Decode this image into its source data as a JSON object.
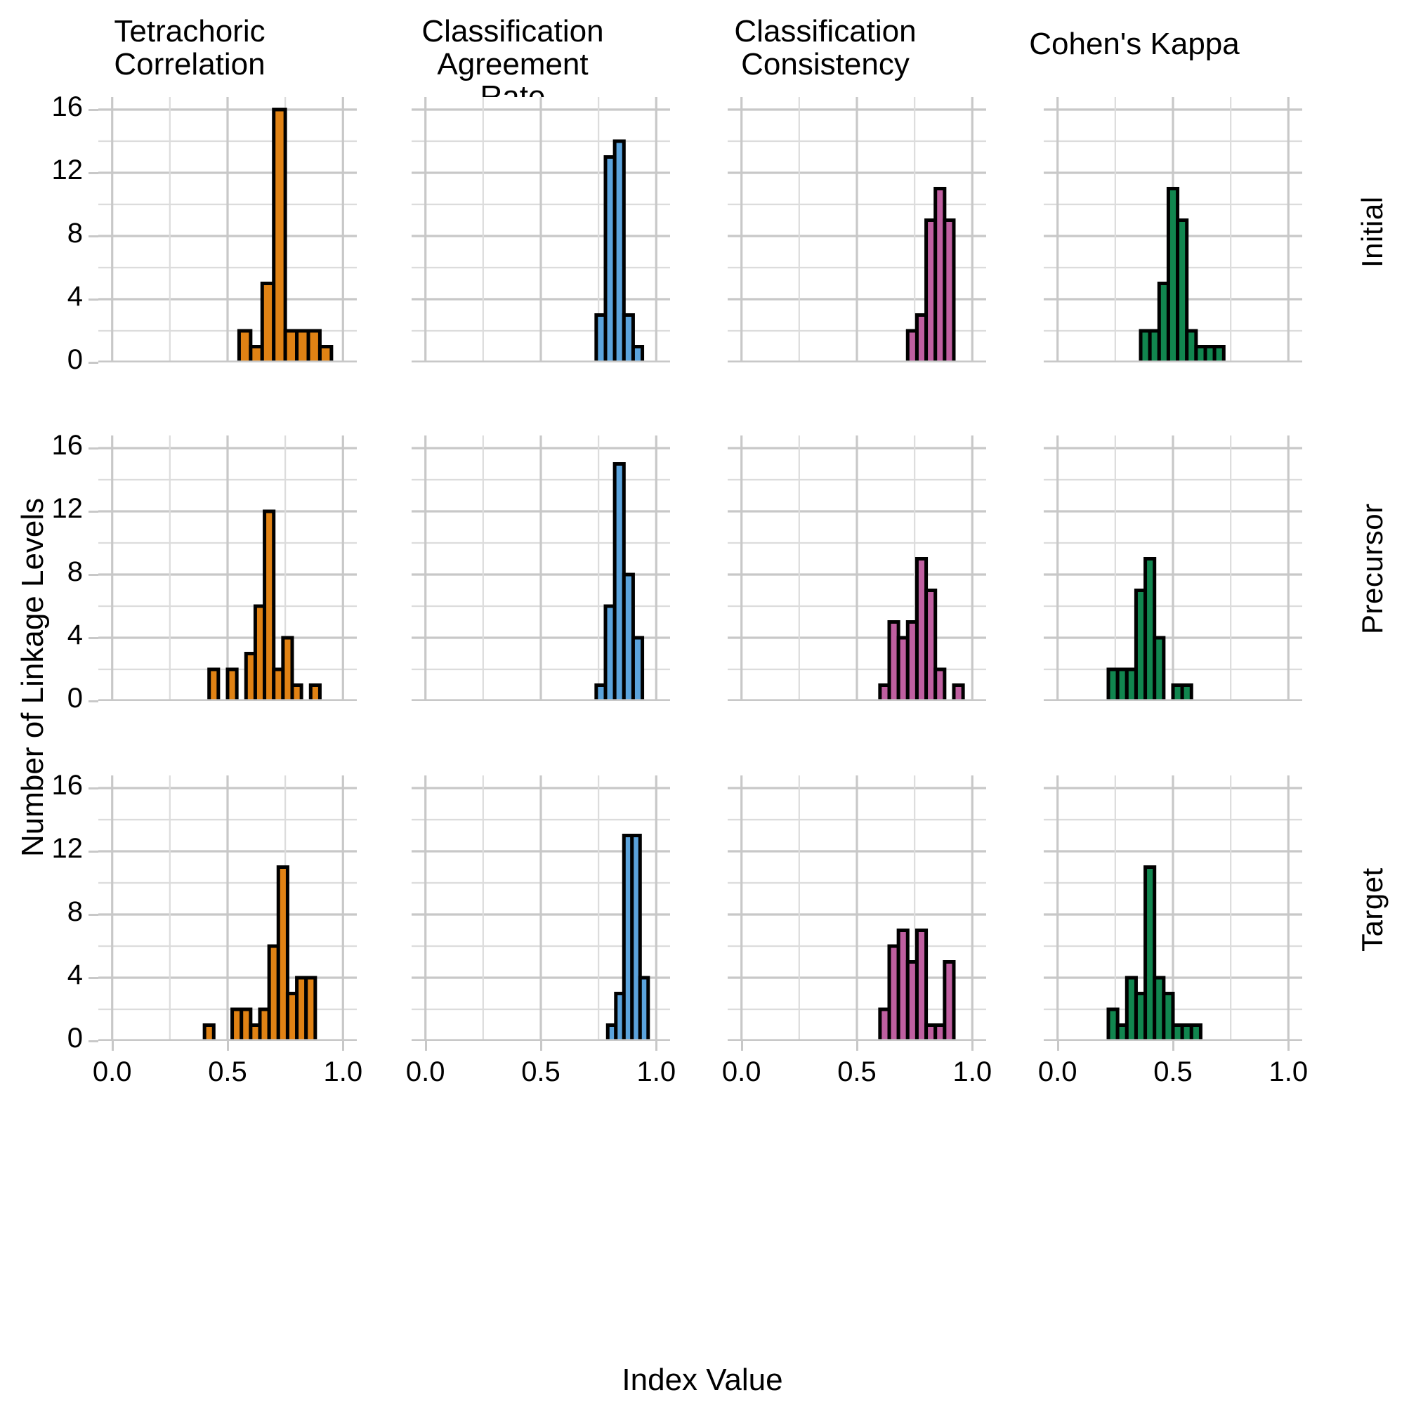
{
  "figure": {
    "xlabel": "Index Value",
    "ylabel": "Number of Linkage Levels",
    "column_titles": [
      "Tetrachoric\nCorrelation",
      "Classification\nAgreement Rate",
      "Classification\nConsistency",
      "Cohen's Kappa"
    ],
    "row_titles": [
      "Initial",
      "Precursor",
      "Target"
    ],
    "colors": {
      "tetrachoric": "#E08214",
      "agreement": "#5BA3DC",
      "consistency": "#BF5FA0",
      "kappa": "#11864F",
      "bar_outline": "#000000",
      "grid_major": "#C8C8C8",
      "grid_minor": "#DCDCDC",
      "background": "#FFFFFF"
    },
    "y_ticks": [
      "0",
      "4",
      "8",
      "12",
      "16"
    ],
    "y_tick_values": [
      0,
      4,
      8,
      12,
      16
    ],
    "y_minor_values": [
      2,
      6,
      10,
      14
    ],
    "x_ticks": [
      "0.0",
      "0.5",
      "1.0"
    ],
    "x_tick_values": [
      0.0,
      0.5,
      1.0
    ],
    "x_minor_values": [
      0.25,
      0.75
    ],
    "ylim": [
      0,
      16.8
    ],
    "xlim": [
      -0.06,
      1.06
    ]
  },
  "chart_data": [
    {
      "type": "bar",
      "panel": "Initial / Tetrachoric Correlation",
      "row": "Initial",
      "column": "Tetrachoric Correlation",
      "title": "Tetrachoric Correlation",
      "xlabel": "Index Value",
      "ylabel": "Number of Linkage Levels",
      "xlim": [
        0.0,
        1.0
      ],
      "ylim": [
        0,
        16
      ],
      "grid": true,
      "color": "#E08214",
      "bin_width": 0.05,
      "bin_starts": [
        0.55,
        0.6,
        0.65,
        0.7,
        0.75,
        0.8,
        0.85,
        0.9
      ],
      "values": [
        2,
        1,
        5,
        16,
        2,
        2,
        2,
        1
      ]
    },
    {
      "type": "bar",
      "panel": "Initial / Classification Agreement Rate",
      "row": "Initial",
      "column": "Classification Agreement Rate",
      "title": "Classification Agreement Rate",
      "xlabel": "Index Value",
      "ylabel": "Number of Linkage Levels",
      "xlim": [
        0.0,
        1.0
      ],
      "ylim": [
        0,
        16
      ],
      "grid": true,
      "color": "#5BA3DC",
      "bin_width": 0.04,
      "bin_starts": [
        0.74,
        0.78,
        0.82,
        0.86,
        0.9
      ],
      "values": [
        3,
        13,
        14,
        3,
        1
      ]
    },
    {
      "type": "bar",
      "panel": "Initial / Classification Consistency",
      "row": "Initial",
      "column": "Classification Consistency",
      "title": "Classification Consistency",
      "xlabel": "Index Value",
      "ylabel": "Number of Linkage Levels",
      "xlim": [
        0.0,
        1.0
      ],
      "ylim": [
        0,
        16
      ],
      "grid": true,
      "color": "#BF5FA0",
      "bin_width": 0.04,
      "bin_starts": [
        0.72,
        0.76,
        0.8,
        0.84,
        0.88
      ],
      "values": [
        2,
        3,
        9,
        11,
        9
      ]
    },
    {
      "type": "bar",
      "panel": "Initial / Cohen's Kappa",
      "row": "Initial",
      "column": "Cohen's Kappa",
      "title": "Cohen's Kappa",
      "xlabel": "Index Value",
      "ylabel": "Number of Linkage Levels",
      "xlim": [
        0.0,
        1.0
      ],
      "ylim": [
        0,
        16
      ],
      "grid": true,
      "color": "#11864F",
      "bin_width": 0.04,
      "bin_starts": [
        0.36,
        0.4,
        0.44,
        0.48,
        0.52,
        0.56,
        0.6,
        0.64,
        0.68
      ],
      "values": [
        2,
        2,
        5,
        11,
        9,
        2,
        1,
        1,
        1
      ]
    },
    {
      "type": "bar",
      "panel": "Precursor / Tetrachoric Correlation",
      "row": "Precursor",
      "column": "Tetrachoric Correlation",
      "title": "Tetrachoric Correlation",
      "xlabel": "Index Value",
      "ylabel": "Number of Linkage Levels",
      "xlim": [
        0.0,
        1.0
      ],
      "ylim": [
        0,
        16
      ],
      "grid": true,
      "color": "#E08214",
      "bin_width": 0.04,
      "bin_starts": [
        0.42,
        0.46,
        0.5,
        0.54,
        0.58,
        0.62,
        0.66,
        0.7,
        0.74,
        0.78,
        0.82,
        0.86
      ],
      "values": [
        2,
        0,
        2,
        0,
        3,
        6,
        12,
        2,
        4,
        1,
        0,
        1
      ]
    },
    {
      "type": "bar",
      "panel": "Precursor / Classification Agreement Rate",
      "row": "Precursor",
      "column": "Classification Agreement Rate",
      "title": "Classification Agreement Rate",
      "xlabel": "Index Value",
      "ylabel": "Number of Linkage Levels",
      "xlim": [
        0.0,
        1.0
      ],
      "ylim": [
        0,
        16
      ],
      "grid": true,
      "color": "#5BA3DC",
      "bin_width": 0.04,
      "bin_starts": [
        0.74,
        0.78,
        0.82,
        0.86,
        0.9
      ],
      "values": [
        1,
        6,
        15,
        8,
        4
      ]
    },
    {
      "type": "bar",
      "panel": "Precursor / Classification Consistency",
      "row": "Precursor",
      "column": "Classification Consistency",
      "title": "Classification Consistency",
      "xlabel": "Index Value",
      "ylabel": "Number of Linkage Levels",
      "xlim": [
        0.0,
        1.0
      ],
      "ylim": [
        0,
        16
      ],
      "grid": true,
      "color": "#BF5FA0",
      "bin_width": 0.04,
      "bin_starts": [
        0.6,
        0.64,
        0.68,
        0.72,
        0.76,
        0.8,
        0.84,
        0.88,
        0.92
      ],
      "values": [
        1,
        5,
        4,
        5,
        9,
        7,
        2,
        0,
        1
      ]
    },
    {
      "type": "bar",
      "panel": "Precursor / Cohen's Kappa",
      "row": "Precursor",
      "column": "Cohen's Kappa",
      "title": "Cohen's Kappa",
      "xlabel": "Index Value",
      "ylabel": "Number of Linkage Levels",
      "xlim": [
        0.0,
        1.0
      ],
      "ylim": [
        0,
        16
      ],
      "grid": true,
      "color": "#11864F",
      "bin_width": 0.04,
      "bin_starts": [
        0.22,
        0.26,
        0.3,
        0.34,
        0.38,
        0.42,
        0.46,
        0.5,
        0.54
      ],
      "values": [
        2,
        2,
        2,
        7,
        9,
        4,
        0,
        1,
        1
      ]
    },
    {
      "type": "bar",
      "panel": "Target / Tetrachoric Correlation",
      "row": "Target",
      "column": "Tetrachoric Correlation",
      "title": "Tetrachoric Correlation",
      "xlabel": "Index Value",
      "ylabel": "Number of Linkage Levels",
      "xlim": [
        0.0,
        1.0
      ],
      "ylim": [
        0,
        16
      ],
      "grid": true,
      "color": "#E08214",
      "bin_width": 0.04,
      "bin_starts": [
        0.4,
        0.44,
        0.48,
        0.52,
        0.56,
        0.6,
        0.64,
        0.68,
        0.72,
        0.76,
        0.8,
        0.84,
        0.88
      ],
      "values": [
        1,
        0,
        0,
        2,
        2,
        1,
        2,
        6,
        11,
        3,
        4,
        4,
        0
      ]
    },
    {
      "type": "bar",
      "panel": "Target / Classification Agreement Rate",
      "row": "Target",
      "column": "Classification Agreement Rate",
      "title": "Classification Agreement Rate",
      "xlabel": "Index Value",
      "ylabel": "Number of Linkage Levels",
      "xlim": [
        0.0,
        1.0
      ],
      "ylim": [
        0,
        16
      ],
      "grid": true,
      "color": "#5BA3DC",
      "bin_width": 0.035,
      "bin_starts": [
        0.79,
        0.825,
        0.86,
        0.895,
        0.93
      ],
      "values": [
        1,
        3,
        13,
        13,
        4
      ]
    },
    {
      "type": "bar",
      "panel": "Target / Classification Consistency",
      "row": "Target",
      "column": "Classification Consistency",
      "title": "Classification Consistency",
      "xlabel": "Index Value",
      "ylabel": "Number of Linkage Levels",
      "xlim": [
        0.0,
        1.0
      ],
      "ylim": [
        0,
        16
      ],
      "grid": true,
      "color": "#BF5FA0",
      "bin_width": 0.04,
      "bin_starts": [
        0.6,
        0.64,
        0.68,
        0.72,
        0.76,
        0.8,
        0.84,
        0.88,
        0.92
      ],
      "values": [
        2,
        6,
        7,
        5,
        7,
        1,
        1,
        5,
        0
      ]
    },
    {
      "type": "bar",
      "panel": "Target / Cohen's Kappa",
      "row": "Target",
      "column": "Cohen's Kappa",
      "title": "Cohen's Kappa",
      "xlabel": "Index Value",
      "ylabel": "Number of Linkage Levels",
      "xlim": [
        0.0,
        1.0
      ],
      "ylim": [
        0,
        16
      ],
      "grid": true,
      "color": "#11864F",
      "bin_width": 0.04,
      "bin_starts": [
        0.22,
        0.26,
        0.3,
        0.34,
        0.38,
        0.42,
        0.46,
        0.5,
        0.54,
        0.58,
        0.62,
        0.66
      ],
      "values": [
        2,
        1,
        4,
        3,
        11,
        4,
        3,
        1,
        1,
        1,
        0,
        0
      ]
    }
  ]
}
